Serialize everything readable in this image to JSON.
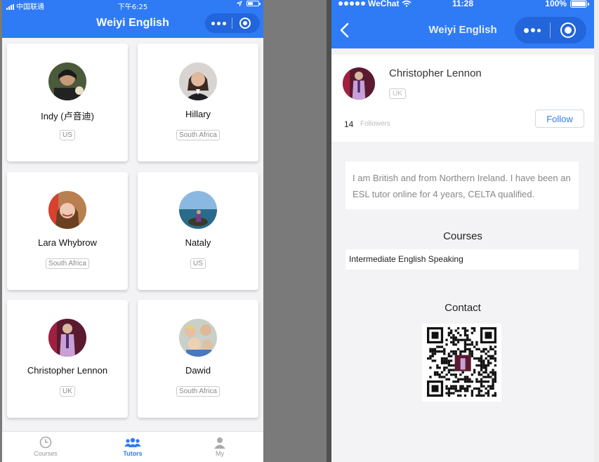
{
  "left": {
    "status": {
      "carrier": "中国联通",
      "time": "下午6:25"
    },
    "nav": {
      "title": "Weiyi English"
    },
    "tutors": [
      {
        "name": "Indy (卢音迪)",
        "country": "US"
      },
      {
        "name": "Hillary",
        "country": "South Africa"
      },
      {
        "name": "Lara Whybrow",
        "country": "South Africa"
      },
      {
        "name": "Nataly",
        "country": "US"
      },
      {
        "name": "Christopher Lennon",
        "country": "UK"
      },
      {
        "name": "Dawid",
        "country": "South Africa"
      }
    ],
    "tabbar": [
      {
        "label": "Courses",
        "icon": "clock-icon",
        "active": false
      },
      {
        "label": "Tutors",
        "icon": "group-icon",
        "active": true
      },
      {
        "label": "My",
        "icon": "person-icon",
        "active": false
      }
    ]
  },
  "right": {
    "status": {
      "carrier": "WeChat",
      "time": "11:28",
      "battery": "100%"
    },
    "nav": {
      "title": "Weiyi English"
    },
    "profile": {
      "name": "Christopher Lennon",
      "country": "UK",
      "followers_count": "14",
      "followers_label": "Followers",
      "follow_label": "Follow"
    },
    "bio": "I am British and from Northern Ireland. I have been an ESL tutor online for 4 years, CELTA qualified.",
    "courses_title": "Courses",
    "courses": [
      "Intermediate English Speaking"
    ],
    "contact_title": "Contact"
  },
  "colors": {
    "accent": "#2f7bf5",
    "background": "#f3f3f5",
    "divider": "#7a7a7a"
  }
}
